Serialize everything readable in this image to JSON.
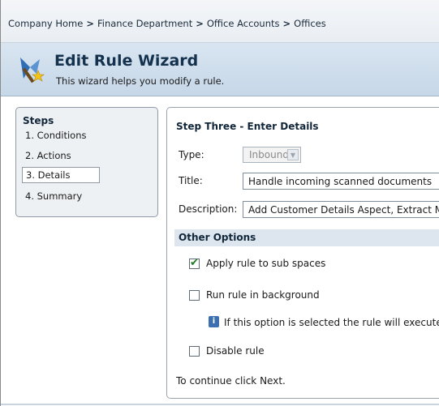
{
  "breadcrumb": {
    "items": [
      "Company Home",
      "Finance Department",
      "Office Accounts",
      "Offices"
    ],
    "separator": ">"
  },
  "header": {
    "title": "Edit Rule Wizard",
    "subtitle": "This wizard helps you modify a rule.",
    "icon": "wizard-wand-icon"
  },
  "steps": {
    "title": "Steps",
    "items": [
      {
        "label": "1. Conditions",
        "active": false
      },
      {
        "label": "2. Actions",
        "active": false
      },
      {
        "label": "3. Details",
        "active": true
      },
      {
        "label": "4. Summary",
        "active": false
      }
    ]
  },
  "details": {
    "heading": "Step Three - Enter Details",
    "type": {
      "label": "Type:",
      "value": "Inbound",
      "disabled": true
    },
    "title": {
      "label": "Title:",
      "value": "Handle incoming scanned documents"
    },
    "description": {
      "label": "Description:",
      "value": "Add Customer Details Aspect, Extract M"
    }
  },
  "options": {
    "header": "Other Options",
    "apply_sub_spaces": {
      "label": "Apply rule to sub spaces",
      "checked": true
    },
    "run_background": {
      "label": "Run rule in background",
      "checked": false
    },
    "background_info": "If this option is selected the rule will execute",
    "disable_rule": {
      "label": "Disable rule",
      "checked": false
    }
  },
  "footer": {
    "continue_text": "To continue click Next."
  },
  "colors": {
    "header_bg": "#c6d7e8",
    "title_color": "#14324e",
    "options_header_bg": "#dde6ef",
    "check_color": "#1f7a25"
  }
}
